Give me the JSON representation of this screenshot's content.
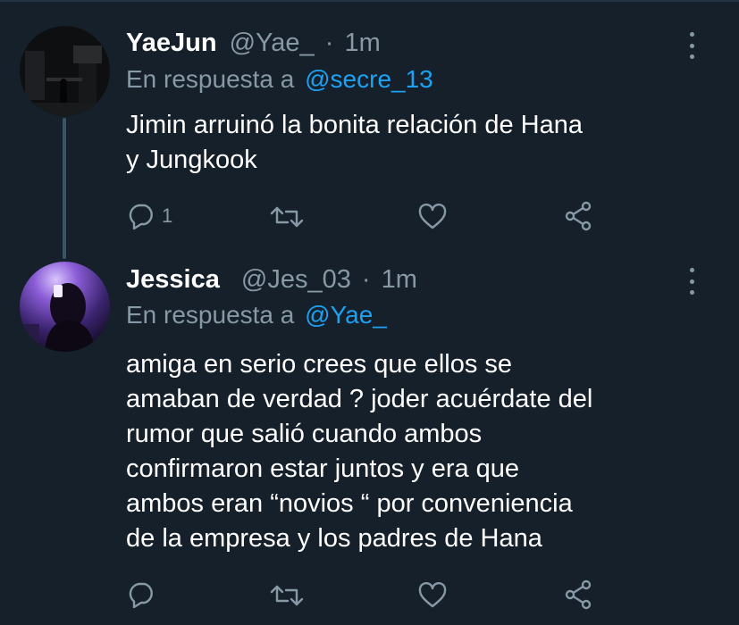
{
  "tweets": [
    {
      "name": "YaeJun",
      "handle": "@Yae_",
      "separator": "·",
      "time": "1m",
      "reply_prefix": "En respuesta a",
      "reply_to": "@secre_13",
      "text_lines": [
        "Jimin arruinó la bonita relación de Hana",
        "y Jungkook"
      ],
      "actions": {
        "reply_count": "1"
      }
    },
    {
      "name": "Jessica",
      "handle": "@Jes_03",
      "separator": "·",
      "time": "1m",
      "reply_prefix": "En respuesta a",
      "reply_to": "@Yae_",
      "text_lines": [
        "amiga en serio crees que ellos se",
        "amaban de verdad ? joder acuérdate del",
        "rumor que salió cuando ambos",
        "confirmaron estar juntos y era que",
        "ambos eran “novios “ por conveniencia",
        "de la empresa y los padres de Hana"
      ],
      "actions": {
        "reply_count": ""
      }
    }
  ],
  "icons": {
    "reply": "reply-icon",
    "retweet": "retweet-icon",
    "like": "heart-icon",
    "share": "share-icon",
    "more": "more-icon"
  },
  "colors": {
    "background": "#15202b",
    "text": "#ffffff",
    "secondary": "#8899a6",
    "accent": "#1da1f2"
  }
}
